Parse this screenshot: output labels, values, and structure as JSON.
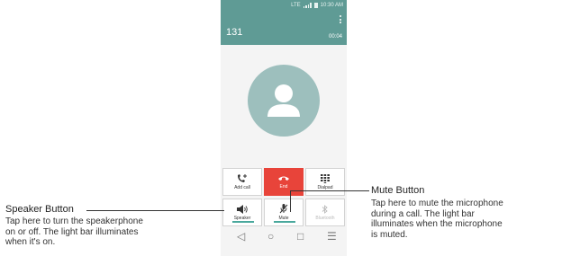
{
  "status_bar": {
    "time": "10:30 AM",
    "network": "LTE"
  },
  "call": {
    "number": "131",
    "duration": "00:04"
  },
  "call_buttons": {
    "add_call": "Add call",
    "end": "End",
    "dialpad": "Dialpad",
    "speaker": "Speaker",
    "mute": "Mute",
    "bluetooth": "Bluetooth"
  },
  "colors": {
    "header": "#5f9b95",
    "end_button": "#e8443a",
    "avatar": "#9dbfbd",
    "light_bar": "#4aa89d"
  },
  "callouts": {
    "speaker": {
      "title": "Speaker Button",
      "lines": [
        "Tap here to turn the speakerphone",
        "on or off. The light bar illuminates",
        "when it's on."
      ]
    },
    "mute": {
      "title": "Mute Button",
      "lines": [
        "Tap here to mute the microphone",
        "during a call. The light bar",
        "illuminates when the microphone",
        "is muted."
      ]
    }
  }
}
